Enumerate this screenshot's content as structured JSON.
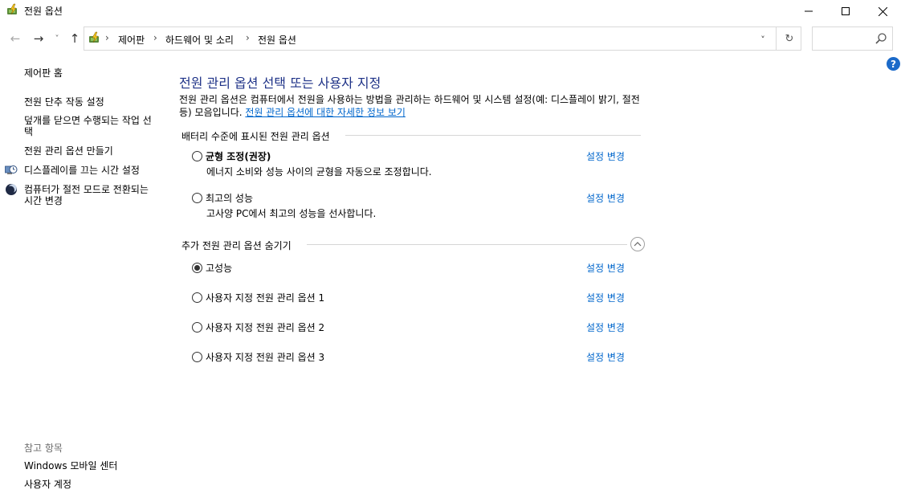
{
  "window": {
    "title": "전원 옵션",
    "min_glyph": "—",
    "max_glyph": "☐",
    "close_glyph": "✕"
  },
  "nav": {
    "back_glyph": "←",
    "forward_glyph": "→",
    "recent_glyph": "˅",
    "up_glyph": "↑"
  },
  "address": {
    "breadcrumbs": [
      "제어판",
      "하드웨어 및 소리",
      "전원 옵션"
    ],
    "sep": "›",
    "dropdown_glyph": "˅",
    "refresh_glyph": "↻"
  },
  "search": {
    "placeholder": ""
  },
  "help": {
    "glyph": "?"
  },
  "sidebar": {
    "home": "제어판 홈",
    "items": [
      {
        "label": "전원 단추 작동 설정"
      },
      {
        "label": "덮개를 닫으면 수행되는 작업 선택"
      },
      {
        "label": "전원 관리 옵션 만들기"
      },
      {
        "label": "디스플레이를 끄는 시간 설정",
        "icon": "display-clock-icon"
      },
      {
        "label": "컴퓨터가 절전 모드로 전환되는 시간 변경",
        "icon": "moon-icon"
      }
    ],
    "see_also": "참고 항목",
    "see_also_items": [
      "Windows 모바일 센터",
      "사용자 계정"
    ]
  },
  "main": {
    "title": "전원 관리 옵션 선택 또는 사용자 지정",
    "desc_text": "전원 관리 옵션은 컴퓨터에서 전원을 사용하는 방법을 관리하는 하드웨어 및 시스템 설정(예: 디스플레이 밝기, 절전 등) 모음입니다. ",
    "desc_link": "전원 관리 옵션에 대한 자세한 정보 보기",
    "battery_section": "배터리 수준에 표시된 전원 관리 옵션",
    "battery_plans": [
      {
        "name": "균형 조정(권장)",
        "desc": "에너지 소비와 성능 사이의 균형을 자동으로 조정합니다.",
        "checked": false
      },
      {
        "name": "최고의 성능",
        "desc": "고사양 PC에서 최고의 성능을 선사합니다.",
        "checked": false
      }
    ],
    "hidden_section": "추가 전원 관리 옵션 숨기기",
    "extra_plans": [
      {
        "name": "고성능",
        "checked": true
      },
      {
        "name": "사용자 지정 전원 관리 옵션 1",
        "checked": false
      },
      {
        "name": "사용자 지정 전원 관리 옵션 2",
        "checked": false
      },
      {
        "name": "사용자 지정 전원 관리 옵션 3",
        "checked": false
      }
    ],
    "change_link": "설정 변경"
  }
}
